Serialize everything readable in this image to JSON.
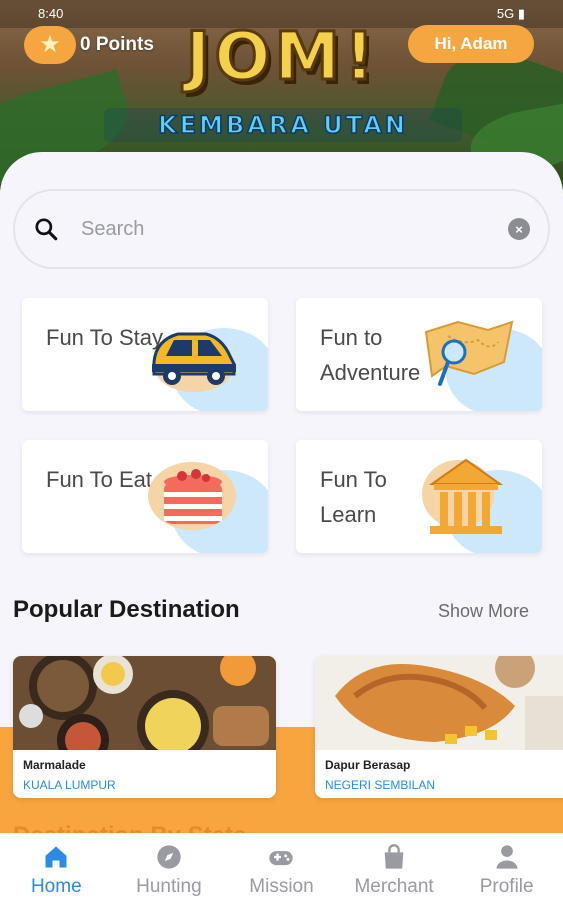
{
  "status_bar": {
    "time": "8:40",
    "right": "5G ▮"
  },
  "header": {
    "logo_main": "JOM!",
    "logo_sub": "KEMBARA UTAN",
    "points": "0 Points",
    "greeting": "Hi, Adam"
  },
  "search": {
    "placeholder": "Search",
    "value": ""
  },
  "categories": [
    {
      "label": "Fun To Stay",
      "icon": "car-icon"
    },
    {
      "label": "Fun to Adventure",
      "icon": "map-icon"
    },
    {
      "label": "Fun To Eat",
      "icon": "cake-icon"
    },
    {
      "label": "Fun To Learn",
      "icon": "museum-icon"
    }
  ],
  "popular": {
    "title": "Popular Destination",
    "show_more": "Show More",
    "items": [
      {
        "name": "Marmalade",
        "location": "KUALA LUMPUR"
      },
      {
        "name": "Dapur Berasap",
        "location": "NEGERI SEMBILAN"
      }
    ]
  },
  "next_section_title": "Destination By State",
  "nav": {
    "items": [
      {
        "label": "Home",
        "icon": "home-icon",
        "active": true
      },
      {
        "label": "Hunting",
        "icon": "compass-icon",
        "active": false
      },
      {
        "label": "Mission",
        "icon": "gamepad-icon",
        "active": false
      },
      {
        "label": "Merchant",
        "icon": "bag-icon",
        "active": false
      },
      {
        "label": "Profile",
        "icon": "person-icon",
        "active": false
      }
    ]
  },
  "colors": {
    "accent": "#f8a540",
    "active": "#2b8be6",
    "inactive": "#9a9aa3"
  }
}
